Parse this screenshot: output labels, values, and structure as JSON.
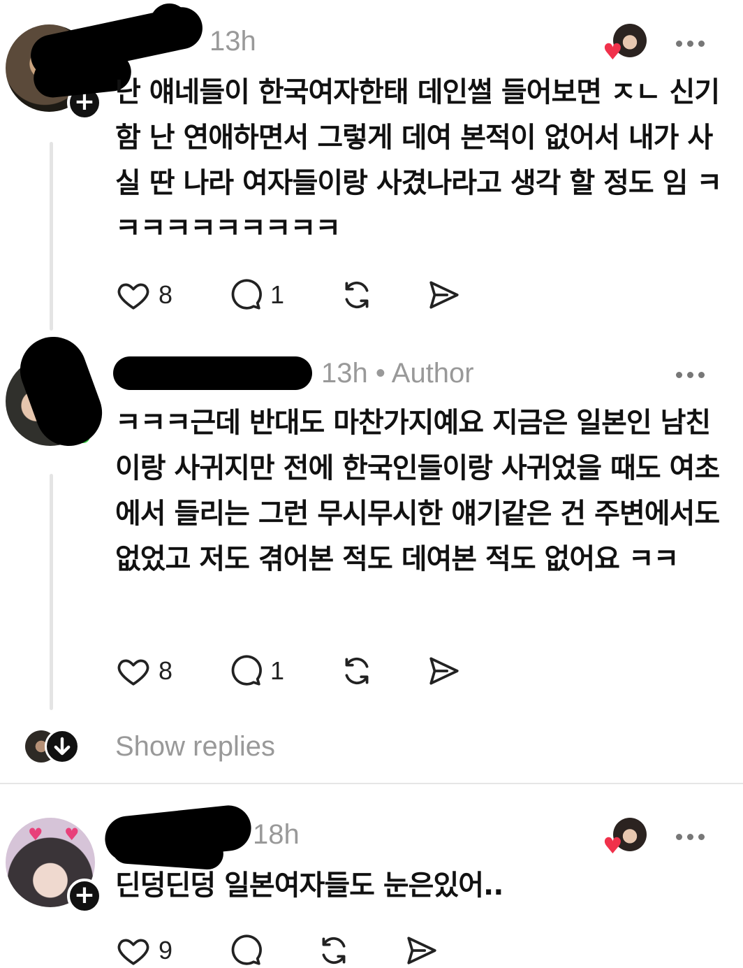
{
  "comments": [
    {
      "time": "13h",
      "text": "난 얘네들이 한국여자한태 데인썰 들어보면 ㅈㄴ 신기함 난 연애하면서 그렇게 데여 본적이 없어서 내가 사실 딴 나라 여자들이랑 사겼나라고 생각 할 정도 임 ㅋㅋㅋㅋㅋㅋㅋㅋㅋㅋ",
      "likes": "8",
      "replies": "1"
    },
    {
      "time": "13h • Author",
      "text": "ㅋㅋㅋ근데 반대도 마찬가지예요 지금은 일본인 남친이랑 사귀지만 전에 한국인들이랑 사귀었을 때도 여초에서 들리는 그런 무시무시한 얘기같은 건 주변에서도 없었고 저도 겪어본 적도 데여본 적도 없어요 ㅋㅋ",
      "likes": "8",
      "replies": "1"
    },
    {
      "time": "18h",
      "text": "딘덩딘덩 일본여자들도 눈은있어..",
      "likes": "9",
      "replies": ""
    }
  ],
  "show_replies_label": "Show replies",
  "icons": {
    "more": "more-dots-icon",
    "like": "heart-icon",
    "reply": "speech-bubble-icon",
    "repost": "repost-icon",
    "share": "send-icon",
    "follow": "plus-icon",
    "expand": "arrow-down-icon"
  },
  "colors": {
    "liked_heart": "#f0314b",
    "online": "#3ecf4a",
    "muted_text": "#999999"
  }
}
